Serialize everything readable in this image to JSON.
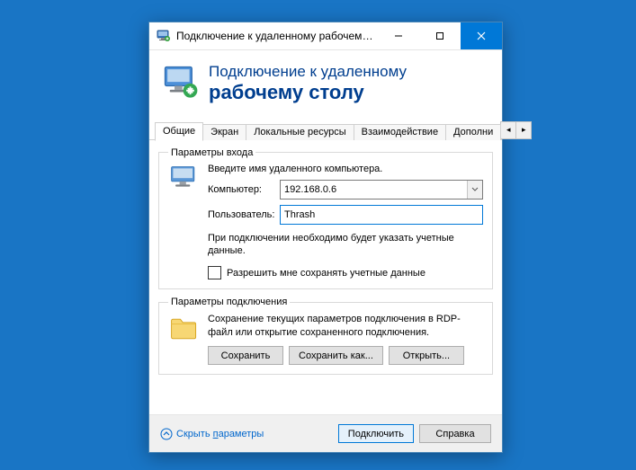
{
  "window": {
    "title": "Подключение к удаленному рабочему с..."
  },
  "header": {
    "line1": "Подключение к удаленному",
    "line2": "рабочему столу"
  },
  "tabs": {
    "t0": "Общие",
    "t1": "Экран",
    "t2": "Локальные ресурсы",
    "t3": "Взаимодействие",
    "t4": "Дополни"
  },
  "login": {
    "legend": "Параметры входа",
    "instruction": "Введите имя удаленного компьютера.",
    "computer_label": "Компьютер:",
    "computer_value": "192.168.0.6",
    "user_label": "Пользователь:",
    "user_value": "Thrash",
    "note": "При подключении необходимо будет указать учетные данные.",
    "remember": "Разрешить мне сохранять учетные данные"
  },
  "conn": {
    "legend": "Параметры подключения",
    "desc": "Сохранение текущих параметров подключения в RDP-файл или открытие сохраненного подключения.",
    "save": "Сохранить",
    "save_as": "Сохранить как...",
    "open": "Открыть..."
  },
  "footer": {
    "hide_prefix": "Скрыть ",
    "hide_underlined": "п",
    "hide_suffix": "араметры",
    "connect": "Подключить",
    "help": "Справка"
  }
}
